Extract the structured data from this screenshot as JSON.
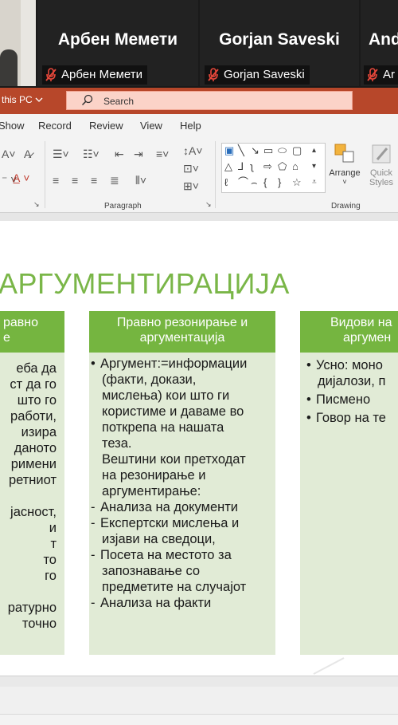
{
  "participants": [
    {
      "name": "Арбен Мемети",
      "tag": "Арбен Мемети",
      "muted": true
    },
    {
      "name": "Gorjan Saveski",
      "tag": "Gorjan Saveski",
      "muted": true
    },
    {
      "name": "And",
      "tag": "Ar",
      "muted": true
    }
  ],
  "titlebar": {
    "save_location": "this PC",
    "search_placeholder": "Search",
    "color": "#b7472a"
  },
  "ribbon_tabs": [
    "Show",
    "Record",
    "Review",
    "View",
    "Help"
  ],
  "ribbon": {
    "group_paragraph": "Paragraph",
    "group_drawing": "Drawing",
    "arrange_label": "Arrange",
    "quick_styles_label_1": "Quick",
    "quick_styles_label_2": "Styles"
  },
  "slide": {
    "title": "АРГУМЕНТИРАЦИЈА",
    "accent": "#75b540",
    "col1": {
      "head_lines": [
        "равно",
        "е"
      ],
      "body_lines": [
        "еба  да",
        "ст  да  го",
        "  што  го",
        "работи,",
        "изира",
        "даното",
        "римени",
        "ретниот",
        "",
        "јасност,",
        "         и",
        "т",
        "то",
        "        го",
        "",
        "ратурно",
        "точно"
      ]
    },
    "col2": {
      "head_lines": [
        "Правно резонирање и",
        "аргументација"
      ],
      "items": [
        {
          "type": "bullet",
          "lines": [
            "Аргумент:=информации",
            "(факти, докази,",
            "мислења) кои што ги",
            "користиме и даваме во",
            "поткрепа на нашата",
            "теза."
          ]
        },
        {
          "type": "plain",
          "lines": [
            " Вештини кои претходат",
            "на резонирање и",
            "аргументирање:"
          ]
        },
        {
          "type": "dash",
          "lines": [
            "Анализа на документи"
          ]
        },
        {
          "type": "dash",
          "lines": [
            "Експертски мислења и",
            "изјави на сведоци,"
          ]
        },
        {
          "type": "dash",
          "lines": [
            "Посета на местото за",
            "запознавање со",
            "предметите на случајот"
          ]
        },
        {
          "type": "dash",
          "lines": [
            "Анализа на факти"
          ]
        }
      ]
    },
    "col3": {
      "head_lines": [
        "Видови на",
        "аргумен"
      ],
      "items": [
        {
          "lines": [
            "Усно: моно",
            "дијалози, п"
          ]
        },
        {
          "lines": [
            "Писмено"
          ]
        },
        {
          "lines": [
            "Говор на те"
          ]
        }
      ]
    }
  }
}
